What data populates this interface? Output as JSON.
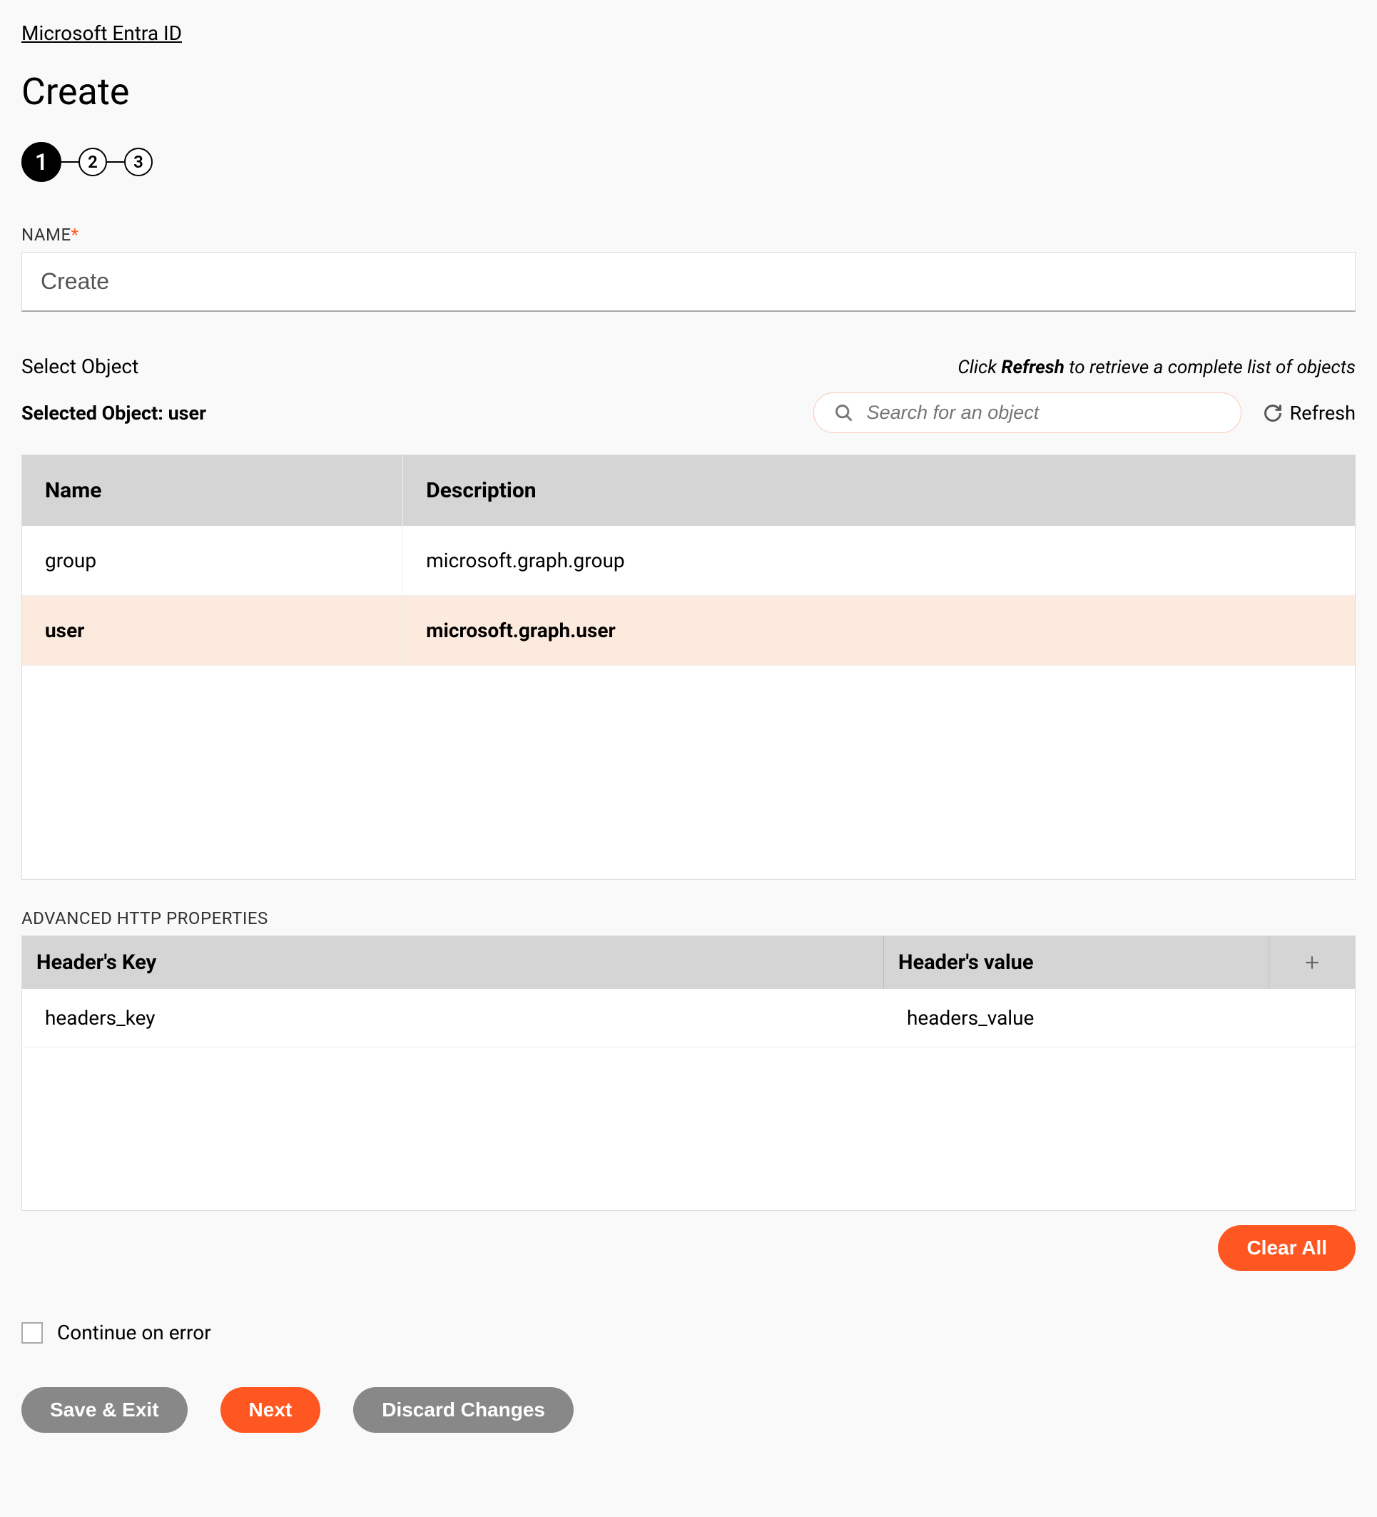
{
  "breadcrumb": "Microsoft Entra ID",
  "page_title": "Create",
  "stepper": {
    "s1": "1",
    "s2": "2",
    "s3": "3"
  },
  "name_field": {
    "label": "NAME",
    "value": "Create"
  },
  "select": {
    "label": "Select Object",
    "hint_prefix": "Click ",
    "hint_bold": "Refresh",
    "hint_suffix": " to retrieve a complete list of objects",
    "selected_prefix": "Selected Object: ",
    "selected_value": "user",
    "search_placeholder": "Search for an object",
    "refresh": "Refresh"
  },
  "object_table": {
    "col_name": "Name",
    "col_desc": "Description",
    "rows": [
      {
        "name": "group",
        "desc": "microsoft.graph.group",
        "selected": false
      },
      {
        "name": "user",
        "desc": "microsoft.graph.user",
        "selected": true
      }
    ]
  },
  "http": {
    "section": "ADVANCED HTTP PROPERTIES",
    "col_key": "Header's Key",
    "col_val": "Header's value",
    "rows": [
      {
        "key": "headers_key",
        "val": "headers_value"
      }
    ]
  },
  "buttons": {
    "clear_all": "Clear All",
    "continue_on_error": "Continue on error",
    "save_exit": "Save & Exit",
    "next": "Next",
    "discard": "Discard Changes"
  }
}
